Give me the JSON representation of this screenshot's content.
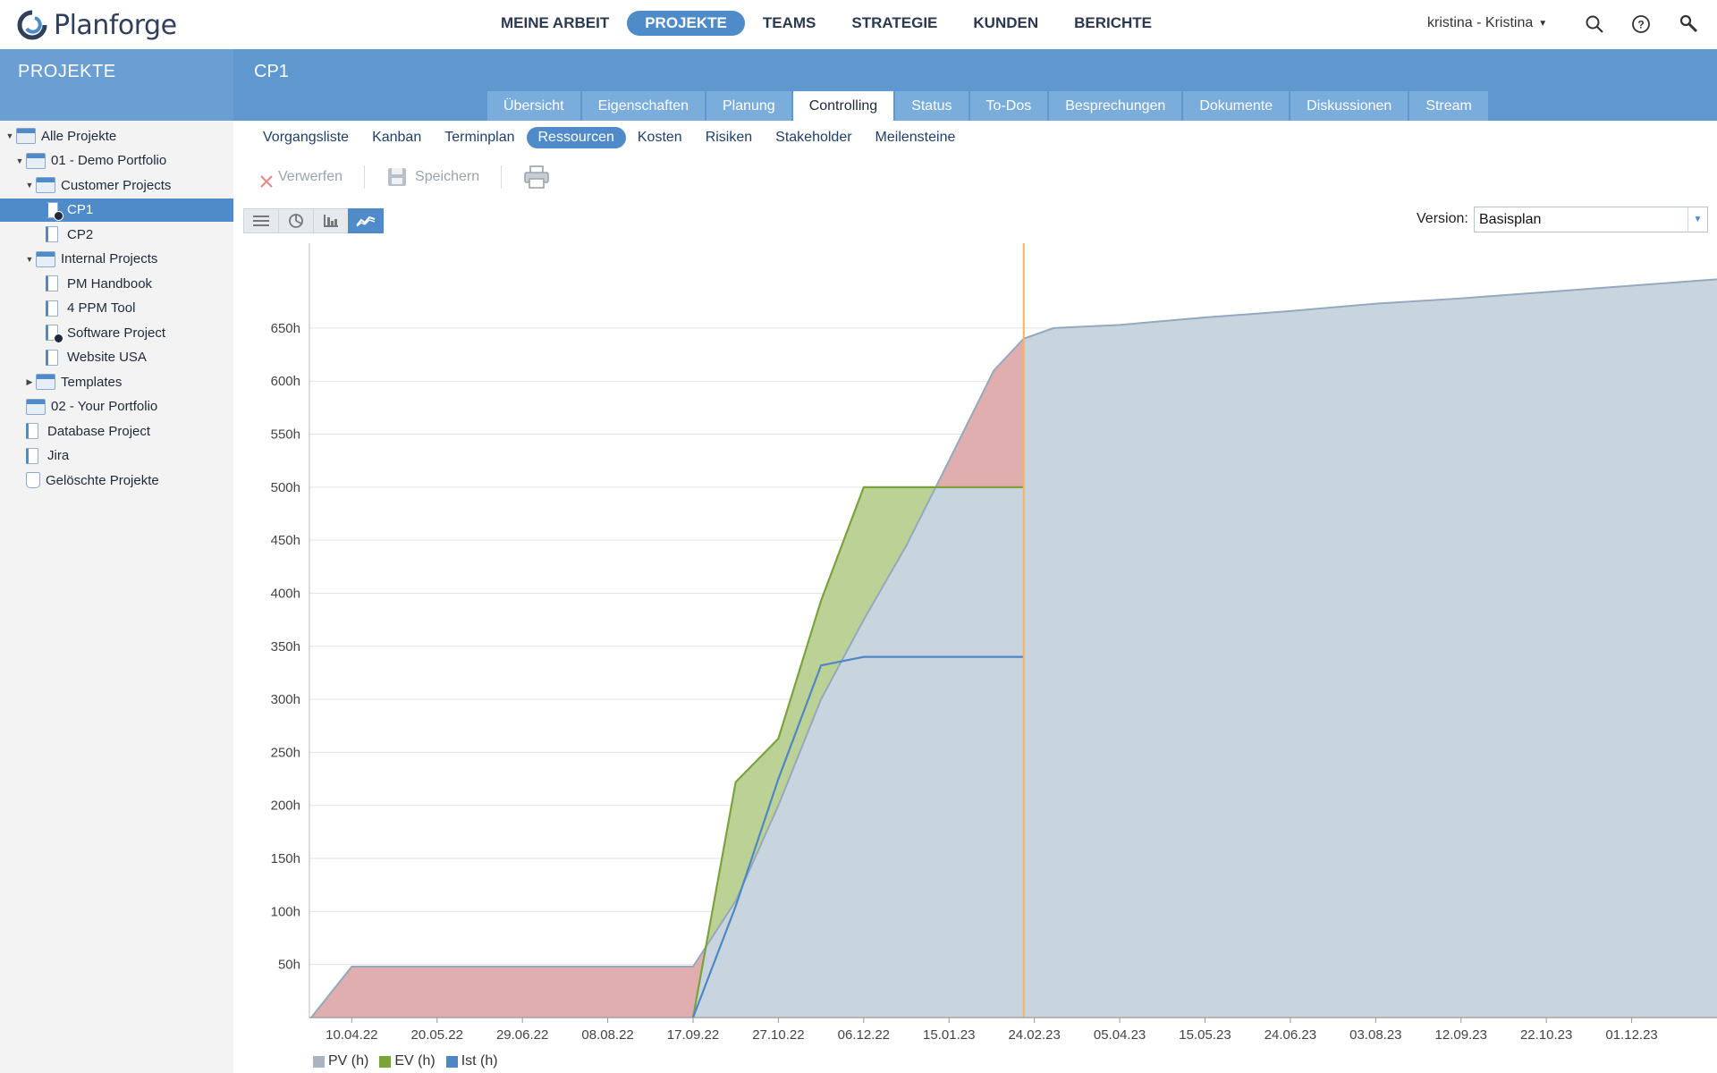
{
  "brand": {
    "name": "Planforge"
  },
  "topnav": {
    "items": [
      {
        "label": "MEINE ARBEIT",
        "active": false
      },
      {
        "label": "PROJEKTE",
        "active": true
      },
      {
        "label": "TEAMS",
        "active": false
      },
      {
        "label": "STRATEGIE",
        "active": false
      },
      {
        "label": "KUNDEN",
        "active": false
      },
      {
        "label": "BERICHTE",
        "active": false
      }
    ],
    "user": "kristina - Kristina",
    "icons": [
      "search-icon",
      "help-icon",
      "wrench-icon"
    ]
  },
  "sidebar": {
    "title": "PROJEKTE",
    "items": [
      {
        "label": "Alle Projekte",
        "level": 0,
        "arrow": "down",
        "icon": "folder",
        "check": false,
        "selected": false
      },
      {
        "label": "01 - Demo Portfolio",
        "level": 1,
        "arrow": "down",
        "icon": "folder",
        "check": false,
        "selected": false
      },
      {
        "label": "Customer Projects",
        "level": 2,
        "arrow": "down",
        "icon": "folder",
        "check": false,
        "selected": false
      },
      {
        "label": "CP1",
        "level": 3,
        "arrow": "",
        "icon": "project",
        "check": true,
        "selected": true
      },
      {
        "label": "CP2",
        "level": 3,
        "arrow": "",
        "icon": "project",
        "check": false,
        "selected": false
      },
      {
        "label": "Internal Projects",
        "level": 2,
        "arrow": "down",
        "icon": "folder",
        "check": false,
        "selected": false
      },
      {
        "label": "PM Handbook",
        "level": 3,
        "arrow": "",
        "icon": "project",
        "check": false,
        "selected": false
      },
      {
        "label": "4 PPM Tool",
        "level": 3,
        "arrow": "",
        "icon": "project",
        "check": false,
        "selected": false
      },
      {
        "label": "Software Project",
        "level": 3,
        "arrow": "",
        "icon": "project",
        "check": true,
        "selected": false
      },
      {
        "label": "Website USA",
        "level": 3,
        "arrow": "",
        "icon": "project",
        "check": false,
        "selected": false
      },
      {
        "label": "Templates",
        "level": 2,
        "arrow": "right",
        "icon": "folder",
        "check": false,
        "selected": false
      },
      {
        "label": "02 - Your Portfolio",
        "level": 1,
        "arrow": "",
        "icon": "folder",
        "check": false,
        "selected": false
      },
      {
        "label": "Database Project",
        "level": 1,
        "arrow": "",
        "icon": "project",
        "check": false,
        "selected": false
      },
      {
        "label": "Jira",
        "level": 1,
        "arrow": "",
        "icon": "project",
        "check": false,
        "selected": false
      },
      {
        "label": "Gelöschte Projekte",
        "level": 1,
        "arrow": "",
        "icon": "trash",
        "check": false,
        "selected": false
      }
    ]
  },
  "project": {
    "title": "CP1",
    "tabs": [
      {
        "label": "Übersicht",
        "active": false
      },
      {
        "label": "Eigenschaften",
        "active": false
      },
      {
        "label": "Planung",
        "active": false
      },
      {
        "label": "Controlling",
        "active": true
      },
      {
        "label": "Status",
        "active": false
      },
      {
        "label": "To-Dos",
        "active": false
      },
      {
        "label": "Besprechungen",
        "active": false
      },
      {
        "label": "Dokumente",
        "active": false
      },
      {
        "label": "Diskussionen",
        "active": false
      },
      {
        "label": "Stream",
        "active": false
      }
    ],
    "subtabs": [
      {
        "label": "Vorgangsliste",
        "active": false
      },
      {
        "label": "Kanban",
        "active": false
      },
      {
        "label": "Terminplan",
        "active": false
      },
      {
        "label": "Ressourcen",
        "active": true
      },
      {
        "label": "Kosten",
        "active": false
      },
      {
        "label": "Risiken",
        "active": false
      },
      {
        "label": "Stakeholder",
        "active": false
      },
      {
        "label": "Meilensteine",
        "active": false
      }
    ]
  },
  "toolbar": {
    "discard_label": "Verwerfen",
    "save_label": "Speichern",
    "views": [
      {
        "icon": "list-view-icon",
        "active": false
      },
      {
        "icon": "pie-view-icon",
        "active": false
      },
      {
        "icon": "bar-view-icon",
        "active": false
      },
      {
        "icon": "line-chart-view-icon",
        "active": true
      }
    ]
  },
  "version": {
    "label": "Version:",
    "value": "Basisplan"
  },
  "chart_data": {
    "type": "area",
    "x_dates": [
      "2022-03-22",
      "2022-04-10",
      "2022-09-17",
      "2022-10-07",
      "2022-10-27",
      "2022-11-16",
      "2022-12-06",
      "2022-12-26",
      "2023-01-15",
      "2023-01-30",
      "2023-02-14",
      "2023-02-24",
      "2023-03-05",
      "2023-04-05",
      "2023-05-15",
      "2023-06-24",
      "2023-08-03",
      "2023-09-12",
      "2023-10-22",
      "2023-12-01",
      "2024-01-10"
    ],
    "x_ticks": [
      "10.04.22",
      "20.05.22",
      "29.06.22",
      "08.08.22",
      "17.09.22",
      "27.10.22",
      "06.12.22",
      "15.01.23",
      "24.02.23",
      "05.04.23",
      "15.05.23",
      "24.06.23",
      "03.08.23",
      "12.09.23",
      "22.10.23",
      "01.12.23"
    ],
    "x_tick_dates": [
      "2022-04-10",
      "2022-05-20",
      "2022-06-29",
      "2022-08-08",
      "2022-09-17",
      "2022-10-27",
      "2022-12-06",
      "2023-01-15",
      "2023-02-24",
      "2023-04-05",
      "2023-05-15",
      "2023-06-24",
      "2023-08-03",
      "2023-09-12",
      "2023-10-22",
      "2023-12-01"
    ],
    "y_ticks": [
      "50h",
      "100h",
      "150h",
      "200h",
      "250h",
      "300h",
      "350h",
      "400h",
      "450h",
      "500h",
      "550h",
      "600h",
      "650h"
    ],
    "ylim": [
      0,
      730
    ],
    "today": "2023-02-19",
    "series": [
      {
        "name": "PV (h)",
        "color": "#aab4c0",
        "points": [
          [
            "2022-03-22",
            0
          ],
          [
            "2022-04-10",
            48
          ],
          [
            "2022-09-17",
            48
          ],
          [
            "2022-10-07",
            110
          ],
          [
            "2022-10-27",
            200
          ],
          [
            "2022-11-16",
            300
          ],
          [
            "2022-12-06",
            375
          ],
          [
            "2022-12-26",
            445
          ],
          [
            "2023-01-15",
            525
          ],
          [
            "2023-02-05",
            610
          ],
          [
            "2023-02-19",
            640
          ],
          [
            "2023-03-05",
            650
          ],
          [
            "2023-04-05",
            653
          ],
          [
            "2023-05-15",
            660
          ],
          [
            "2023-06-24",
            666
          ],
          [
            "2023-08-03",
            673
          ],
          [
            "2023-09-12",
            678
          ],
          [
            "2023-10-22",
            684
          ],
          [
            "2023-12-01",
            690
          ],
          [
            "2024-01-10",
            696
          ]
        ]
      },
      {
        "name": "EV (h)",
        "color": "#7aa33d",
        "points": [
          [
            "2022-09-17",
            0
          ],
          [
            "2022-10-07",
            222
          ],
          [
            "2022-10-27",
            263
          ],
          [
            "2022-11-16",
            393
          ],
          [
            "2022-12-06",
            500
          ],
          [
            "2023-02-19",
            500
          ]
        ]
      },
      {
        "name": "Ist (h)",
        "color": "#4f86c6",
        "points": [
          [
            "2022-09-17",
            0
          ],
          [
            "2022-10-07",
            105
          ],
          [
            "2022-10-27",
            225
          ],
          [
            "2022-11-16",
            332
          ],
          [
            "2022-12-06",
            340
          ],
          [
            "2023-02-19",
            340
          ]
        ]
      }
    ],
    "legend": [
      "PV (h)",
      "EV (h)",
      "Ist (h)"
    ],
    "legend_placement": "bottom-left",
    "colors": {
      "pv_fill": "#c9d5de",
      "ev_fill": "#bcd195",
      "behind_fill": "#e1aeb0",
      "today_line": "#f2b36b",
      "grid": "#e3e3e3"
    }
  }
}
